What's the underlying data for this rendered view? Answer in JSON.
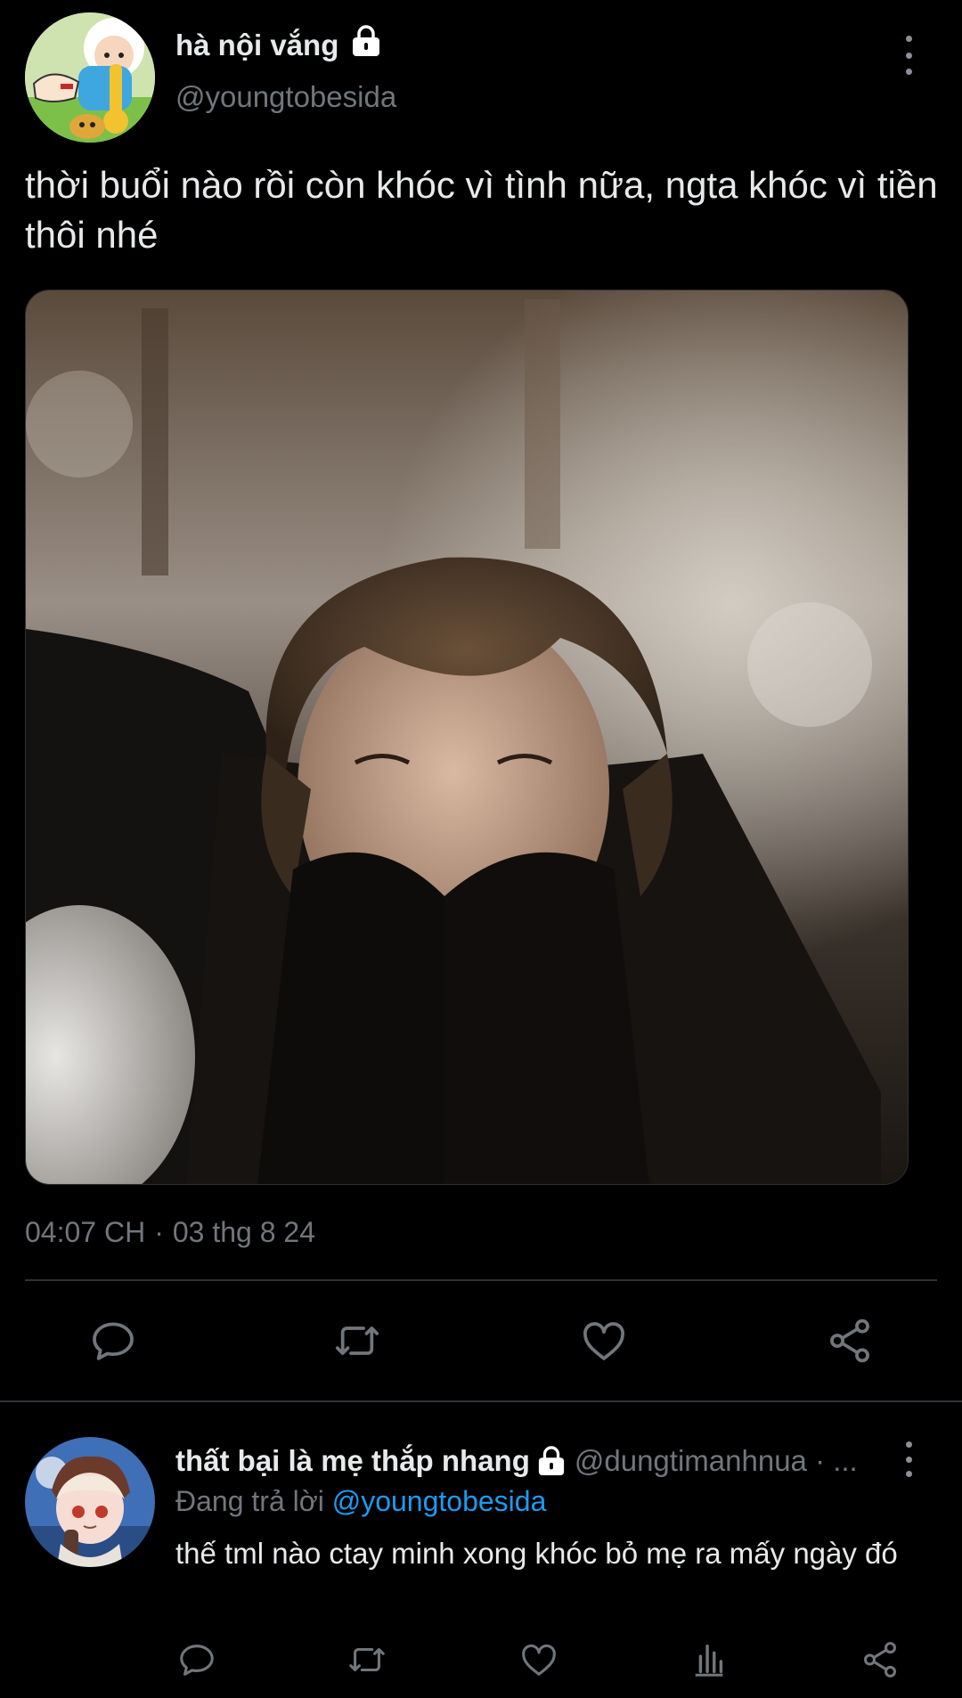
{
  "main_tweet": {
    "display_name": "hà nội vắng",
    "handle": "@youngtobesida",
    "text": "thời buổi nào rồi còn khóc vì tình nữa, ngta khóc vì tiền thôi nhé",
    "timestamp": {
      "time": "04:07 CH",
      "separator": "·",
      "date": "03 thg 8 24"
    },
    "avatar_icon": "cartoon-avatar",
    "lock_icon": "lock-icon",
    "more_icon": "more-vertical-icon",
    "actions": [
      "reply-icon",
      "retweet-icon",
      "like-icon",
      "share-icon"
    ]
  },
  "reply": {
    "display_name": "thất bại là mẹ thắp nhang",
    "handle": "@dungtimanhnua · ...",
    "replying_prefix": "Đang trả lời",
    "replying_to": "@youngtobesida",
    "text": "thế tml nào ctay minh xong khóc bỏ mẹ ra mấy ngày đó",
    "actions": [
      "reply-icon",
      "retweet-icon",
      "like-icon",
      "analytics-icon",
      "share-icon"
    ]
  },
  "colors": {
    "background": "#000000",
    "text_primary": "#e7e9ea",
    "text_secondary": "#71767b",
    "accent_link": "#1d9bf0",
    "divider": "#2f3336"
  }
}
